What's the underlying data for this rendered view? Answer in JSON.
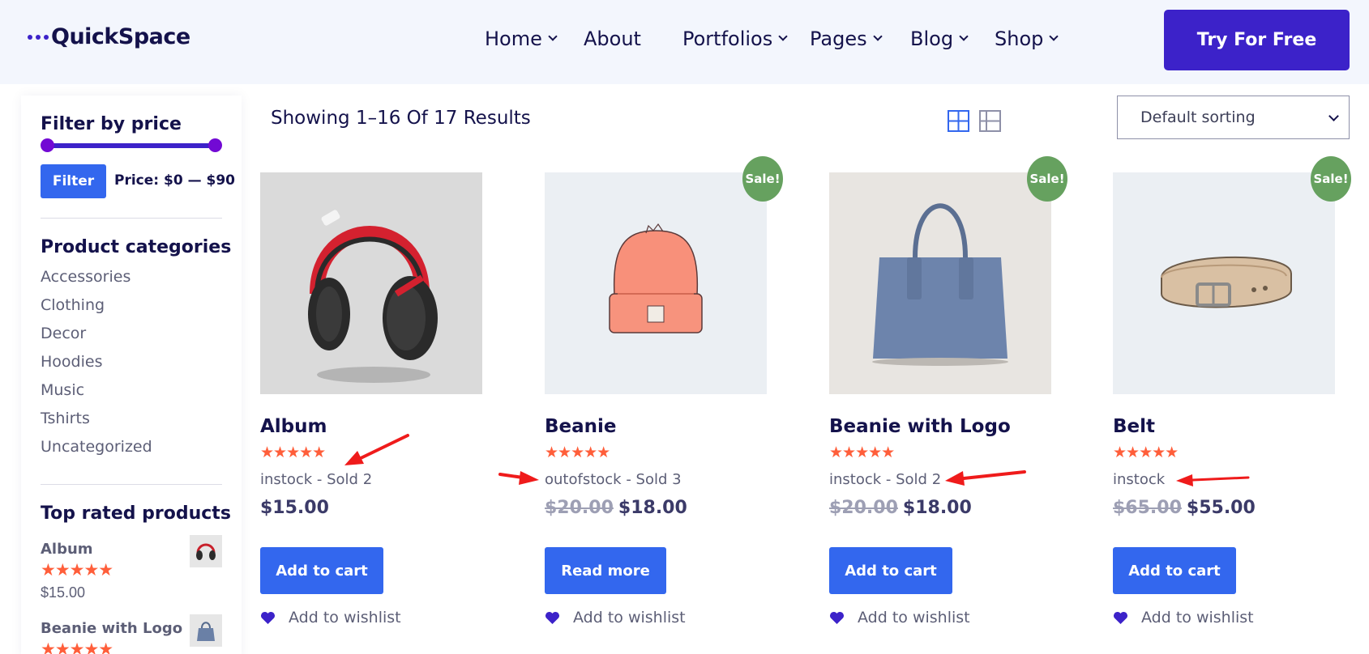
{
  "header": {
    "logo_text": "QuickSpace",
    "nav": [
      {
        "label": "Home",
        "dropdown": true
      },
      {
        "label": "About",
        "dropdown": false
      },
      {
        "label": "Portfolios",
        "dropdown": true
      },
      {
        "label": "Pages",
        "dropdown": true
      },
      {
        "label": "Blog",
        "dropdown": true
      },
      {
        "label": "Shop",
        "dropdown": true
      }
    ],
    "cta_label": "Try For Free"
  },
  "sidebar": {
    "filter_title": "Filter by price",
    "filter_button": "Filter",
    "price_range": "Price: $0 — $90",
    "categories_title": "Product categories",
    "categories": [
      "Accessories",
      "Clothing",
      "Decor",
      "Hoodies",
      "Music",
      "Tshirts",
      "Uncategorized"
    ],
    "top_rated_title": "Top rated products",
    "top_rated": [
      {
        "name": "Album",
        "stars": "★★★★★",
        "price": "$15.00"
      },
      {
        "name": "Beanie with Logo",
        "stars": "★★★★★",
        "price": ""
      }
    ]
  },
  "toolbar": {
    "results_text": "Showing 1–16 Of 17 Results",
    "sort_selected": "Default sorting",
    "grid_view_icon": "grid-icon",
    "list_view_icon": "list-icon"
  },
  "products": [
    {
      "name": "Album",
      "stars": "★★★★★",
      "stock": "instock - Sold 2",
      "old_price": "",
      "price": "$15.00",
      "button": "Add to cart",
      "wishlist": "Add to wishlist",
      "sale": ""
    },
    {
      "name": "Beanie",
      "stars": "★★★★★",
      "stock": "outofstock - Sold 3",
      "old_price": "$20.00",
      "price": "$18.00",
      "button": "Read more",
      "wishlist": "Add to wishlist",
      "sale": "Sale!"
    },
    {
      "name": "Beanie with Logo",
      "stars": "★★★★★",
      "stock": "instock - Sold 2",
      "old_price": "$20.00",
      "price": "$18.00",
      "button": "Add to cart",
      "wishlist": "Add to wishlist",
      "sale": "Sale!"
    },
    {
      "name": "Belt",
      "stars": "★★★★★",
      "stock": "instock",
      "old_price": "$65.00",
      "price": "$55.00",
      "button": "Add to cart",
      "wishlist": "Add to wishlist",
      "sale": "Sale!"
    }
  ],
  "colors": {
    "brand": "#3c22c9",
    "button": "#3367ee",
    "star": "#ff5e3a",
    "sale_badge": "#66a15f",
    "annotation_arrow": "#ef1b1b"
  }
}
